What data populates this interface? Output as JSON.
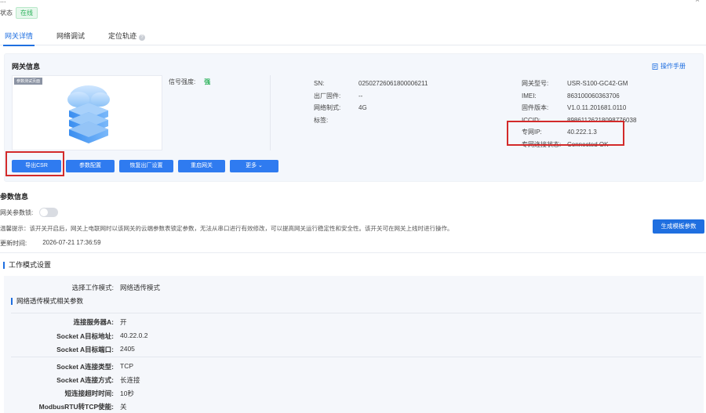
{
  "topbar": {
    "title": "...",
    "close": "×"
  },
  "status": {
    "label": "状态",
    "value": "在线"
  },
  "tabs": [
    {
      "label": "网关详情",
      "active": true
    },
    {
      "label": "网络调试",
      "active": false
    },
    {
      "label": "定位轨迹",
      "active": false
    }
  ],
  "gateway": {
    "title": "网关信息",
    "manual_link": "操作手册",
    "device_tag": "参数测试页面",
    "signal": {
      "label": "信号强度:",
      "value": "强"
    },
    "col1": [
      {
        "k": "SN:",
        "v": "02502726061800006211"
      },
      {
        "k": "出厂固件:",
        "v": "--"
      },
      {
        "k": "网络制式:",
        "v": "4G"
      },
      {
        "k": "标签:",
        "v": ""
      }
    ],
    "col2": [
      {
        "k": "网关型号:",
        "v": "USR-S100-GC42-GM"
      },
      {
        "k": "IMEI:",
        "v": "863100060363706"
      },
      {
        "k": "固件版本:",
        "v": "V1.0.11.201681.0110"
      },
      {
        "k": "ICCID:",
        "v": "89861126218098776038"
      },
      {
        "k": "专网IP:",
        "v": "40.222.1.3"
      },
      {
        "k": "专网连接状态:",
        "v": "Connected OK"
      }
    ],
    "buttons": [
      {
        "label": "导出CSR"
      },
      {
        "label": "参数配置"
      },
      {
        "label": "恢复出厂设置"
      },
      {
        "label": "重启网关"
      },
      {
        "label": "更多"
      }
    ]
  },
  "params": {
    "title": "参数信息",
    "switch_label": "网关参数锁:",
    "tip": "温馨提示：该开关开启后，网关上电联网时以该网关的云端参数表锁定参数，无法从串口进行有效修改，可以提高网关运行稳定性和安全性。该开关可在网关上线时进行操作。",
    "generate_button": "生成模板参数",
    "update_label": "更新时间:",
    "update_value": "2026-07-21 17:36:59"
  },
  "work": {
    "title": "工作模式设置",
    "mode": {
      "k": "选择工作模式:",
      "v": "网络透传模式"
    },
    "sub_title": "网络透传模式相关参数",
    "rows": [
      {
        "k": "连接服务器A:",
        "v": "开"
      },
      {
        "k": "Socket A目标地址:",
        "v": "40.22.0.2"
      },
      {
        "k": "Socket A目标端口:",
        "v": "2405"
      },
      {
        "k": "Socket A连接类型:",
        "v": "TCP"
      },
      {
        "k": "Socket A连接方式:",
        "v": "长连接"
      },
      {
        "k": "短连接超时时间:",
        "v": "10秒"
      },
      {
        "k": "ModbusRTU转TCP使能:",
        "v": "关"
      }
    ]
  },
  "colors": {
    "primary": "#2f7bf0",
    "online_green": "#2bb25a",
    "highlight_red": "#d32a2a"
  }
}
